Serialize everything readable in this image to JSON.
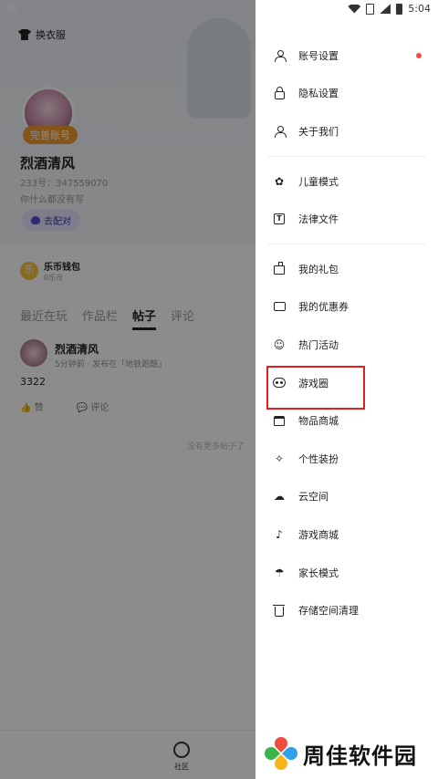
{
  "status_bar": {
    "time": "5:04"
  },
  "profile": {
    "dress_label": "换衣服",
    "badge": "完善账号",
    "nickname": "烈酒清风",
    "uid": "233号：347559070",
    "bio": "你什么都没有写",
    "match_label": "去配对",
    "wallet_name": "乐币钱包",
    "wallet_balance": "0乐币",
    "coin_char": "乐",
    "tabs": [
      "最近在玩",
      "作品栏",
      "帖子",
      "评论"
    ],
    "active_tab": "帖子",
    "post": {
      "author": "烈酒清风",
      "meta": "5分钟前 · 发布在「地铁跑酷」",
      "text": "3322",
      "like_label": "赞",
      "comment_label": "评论"
    },
    "no_more": "没有更多帖子了",
    "bottom_nav_label": "社区"
  },
  "drawer": {
    "groups": [
      [
        {
          "label": "账号设置",
          "icon": "user-icon",
          "red_dot": true
        },
        {
          "label": "隐私设置",
          "icon": "lock-icon"
        },
        {
          "label": "关于我们",
          "icon": "person-icon"
        }
      ],
      [
        {
          "label": "儿童模式",
          "icon": "sprout-icon"
        },
        {
          "label": "法律文件",
          "icon": "document-t-icon"
        }
      ],
      [
        {
          "label": "我的礼包",
          "icon": "gift-icon"
        },
        {
          "label": "我的优惠券",
          "icon": "ticket-icon"
        },
        {
          "label": "热门活动",
          "icon": "smile-icon"
        },
        {
          "label": "游戏圈",
          "icon": "gamepad-icon",
          "highlighted": true
        },
        {
          "label": "物品商城",
          "icon": "store-icon"
        },
        {
          "label": "个性装扮",
          "icon": "sparkle-icon"
        },
        {
          "label": "云空间",
          "icon": "cloud-icon"
        },
        {
          "label": "游戏商城",
          "icon": "music-note-icon"
        },
        {
          "label": "家长模式",
          "icon": "umbrella-icon"
        },
        {
          "label": "存储空间清理",
          "icon": "trash-icon"
        }
      ]
    ],
    "highlight_color": "#e02020"
  },
  "watermark": {
    "text": "周佳软件园"
  }
}
